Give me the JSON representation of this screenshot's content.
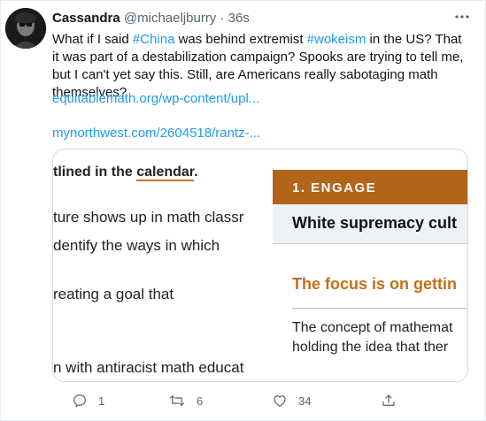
{
  "tweet": {
    "author_name": "Cassandra",
    "handle": "@michaeljburry",
    "separator": "·",
    "time": "36s",
    "text_parts": {
      "p1": "What if I said ",
      "tag1": "#China",
      "p2": " was behind extremist ",
      "tag2": "#wokeism",
      "p3": " in the US? That it was part of a destabilization campaign? Spooks are trying to tell me, but I can't yet say this.  Still, are Americans really sabotaging math themselves?"
    },
    "links": [
      "equitablemath.org/wp-content/upl...",
      "mynorthwest.com/2604518/rantz-..."
    ]
  },
  "card": {
    "left_lines": {
      "l1a": "tlined in the ",
      "l1b": "calendar",
      "l1c": ".",
      "l2": "ture shows up in math classr",
      "l3": "dentify the ways in which",
      "l4": "reating a goal that",
      "l5": "n with antiracist math educat"
    },
    "engage": "1. ENGAGE",
    "white_supremacy": "White supremacy cult",
    "focus": "The focus is on gettin",
    "concept_1": "The concept of mathemat",
    "concept_2": "holding the idea that ther"
  },
  "actions": {
    "reply_count": "1",
    "retweet_count": "6",
    "like_count": "34"
  },
  "icons": {
    "avatar": "avatar-image",
    "more": "more-icon",
    "reply": "reply-icon",
    "retweet": "retweet-icon",
    "like": "heart-icon",
    "share": "share-icon"
  }
}
